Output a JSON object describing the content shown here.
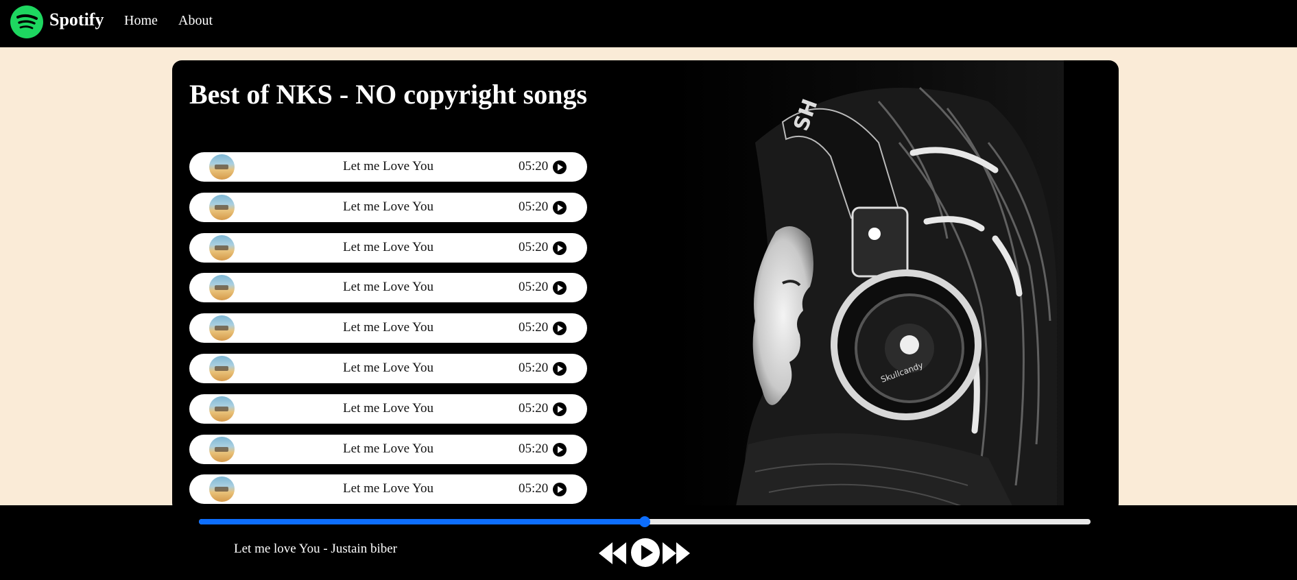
{
  "navbar": {
    "brand": "Spotify",
    "links": [
      "Home",
      "About"
    ],
    "logo_icon": "spotify-logo-icon",
    "logo_color": "#1ed760"
  },
  "main": {
    "title": "Best of NKS - NO copyright songs",
    "songs": [
      {
        "name": "Let me Love You",
        "duration": "05:20"
      },
      {
        "name": "Let me Love You",
        "duration": "05:20"
      },
      {
        "name": "Let me Love You",
        "duration": "05:20"
      },
      {
        "name": "Let me Love You",
        "duration": "05:20"
      },
      {
        "name": "Let me Love You",
        "duration": "05:20"
      },
      {
        "name": "Let me Love You",
        "duration": "05:20"
      },
      {
        "name": "Let me Love You",
        "duration": "05:20"
      },
      {
        "name": "Let me Love You",
        "duration": "05:20"
      },
      {
        "name": "Let me Love You",
        "duration": "05:20"
      }
    ]
  },
  "player": {
    "now_playing": "Let me love You - Justain biber",
    "progress_fraction": 0.5,
    "accent_color": "#0d6efd",
    "icons": [
      "previous-icon",
      "play-icon",
      "next-icon"
    ]
  },
  "colors": {
    "page_background": "#faebd7",
    "bar_background": "#000000"
  }
}
